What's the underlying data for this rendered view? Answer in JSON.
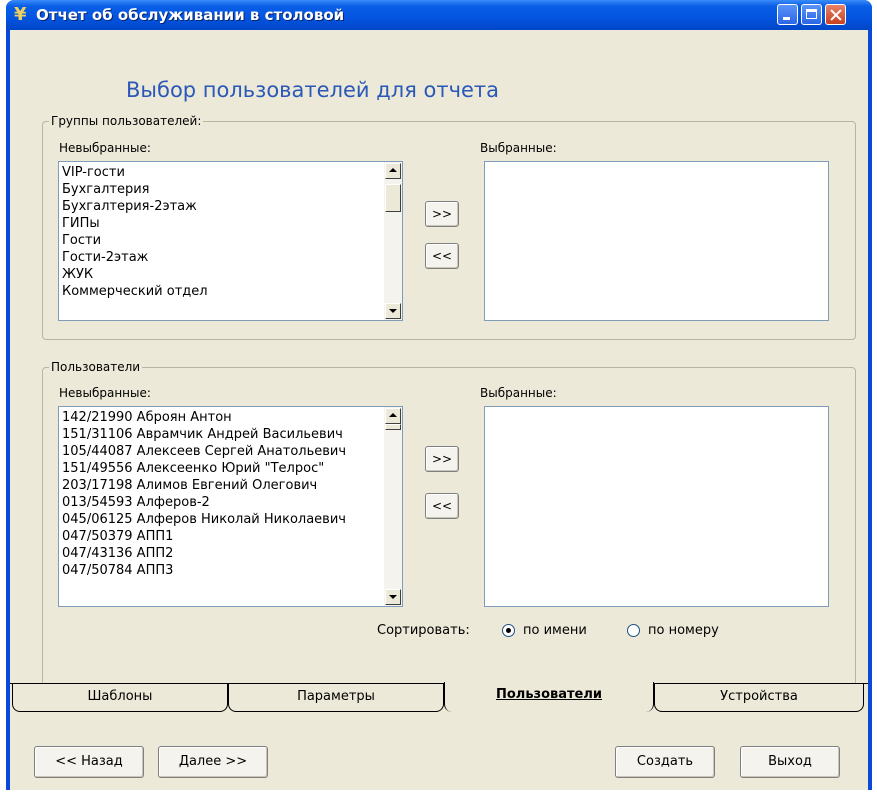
{
  "window": {
    "title": "Отчет об обслуживании в столовой",
    "app_icon": "fork-knife-icon"
  },
  "heading": "Выбор пользователей для отчета",
  "groups_section": {
    "legend": "Группы пользователей:",
    "unselected_label": "Невыбранные:",
    "selected_label": "Выбранные:",
    "unselected_items": [
      "VIP-гости",
      "Бухгалтерия",
      "Бухгалтерия-2этаж",
      "ГИПы",
      "Гости",
      "Гости-2этаж",
      "ЖУК",
      "Коммерческий отдел"
    ],
    "selected_items": [],
    "add_label": ">>",
    "remove_label": "<<"
  },
  "users_section": {
    "legend": "Пользователи",
    "unselected_label": "Невыбранные:",
    "selected_label": "Выбранные:",
    "unselected_items": [
      "142/21990 Аброян Антон",
      "151/31106 Аврамчик Андрей Васильевич",
      "105/44087 Алексеев Сергей Анатольевич",
      "151/49556 Алексеенко Юрий \"Телрос\"",
      "203/17198 Алимов Евгений Олегович",
      "013/54593 Алферов-2",
      "045/06125 Алферов Николай Николаевич",
      "047/50379 АПП1",
      "047/43136 АПП2",
      "047/50784 АПП3"
    ],
    "selected_items": [],
    "add_label": ">>",
    "remove_label": "<<",
    "sort_label": "Сортировать:",
    "sort_by_name": "по имени",
    "sort_by_number": "по номеру",
    "sort_selected": "name"
  },
  "tabs": [
    {
      "label": "Шаблоны"
    },
    {
      "label": "Параметры"
    },
    {
      "label": "Пользователи"
    },
    {
      "label": "Устройства"
    }
  ],
  "active_tab": "Пользователи",
  "footer": {
    "back": "<< Назад",
    "next": "Далее >>",
    "create": "Создать",
    "exit": "Выход"
  }
}
